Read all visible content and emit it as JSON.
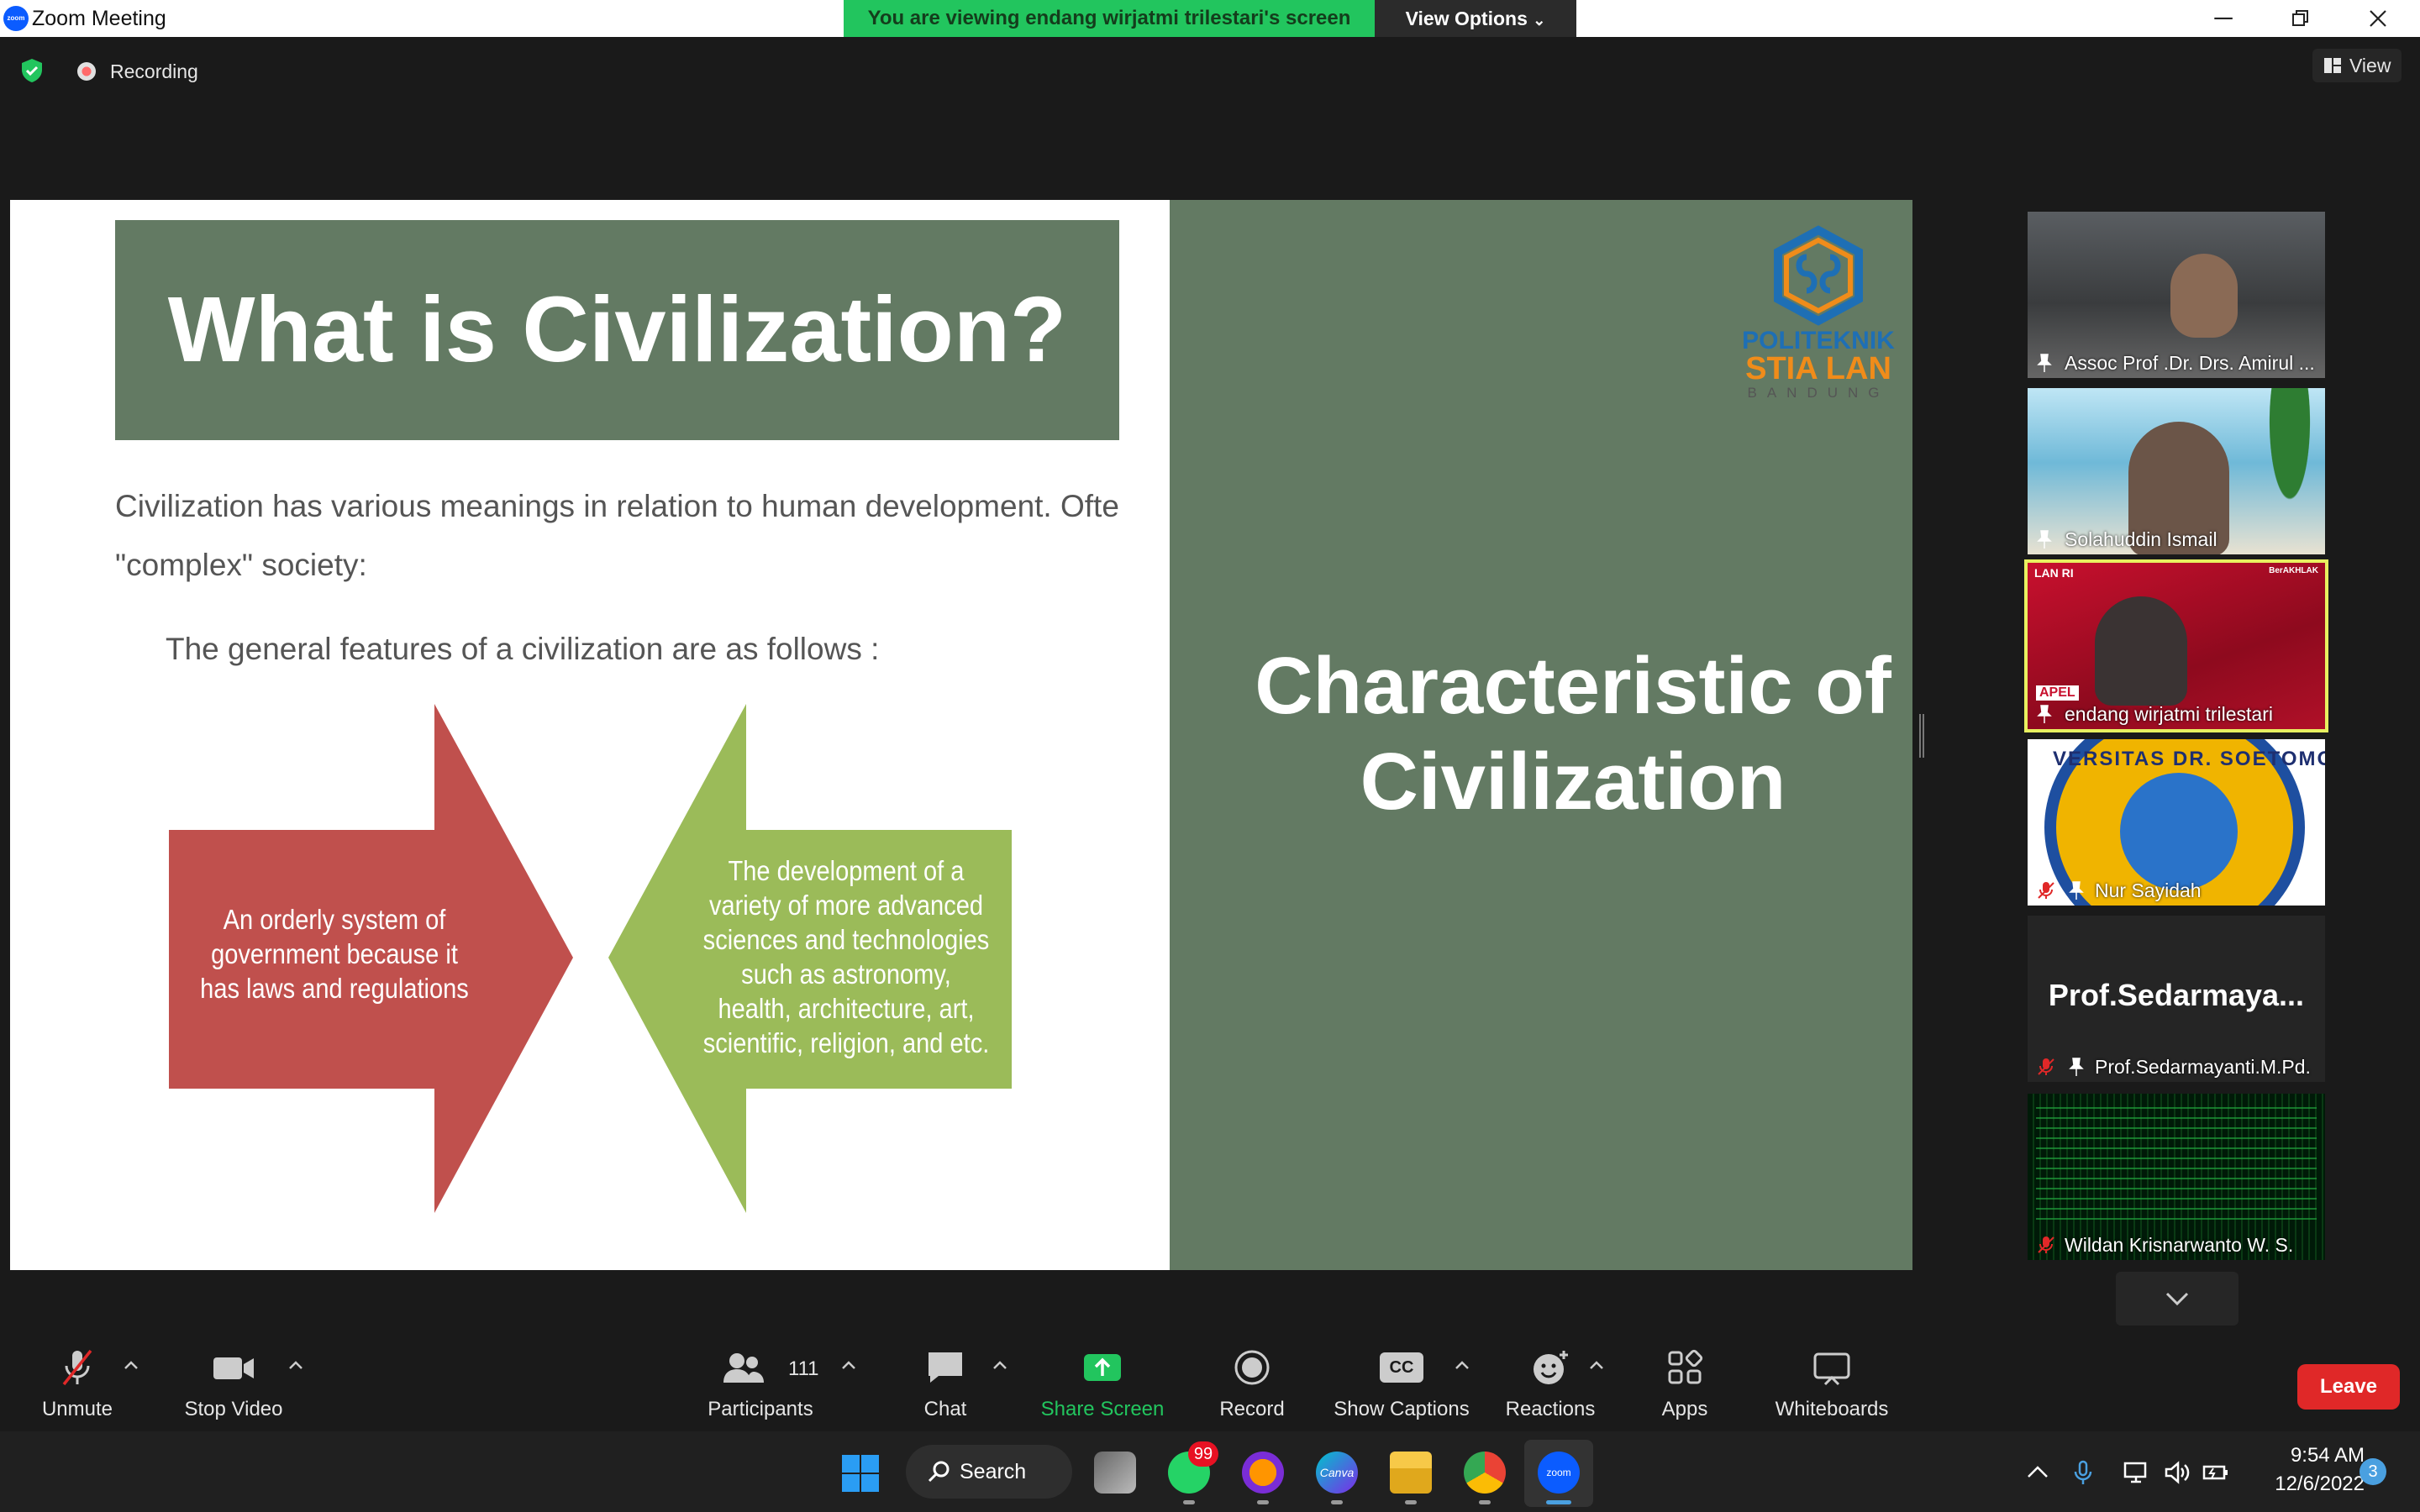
{
  "window": {
    "title": "Zoom Meeting",
    "app_logo_text": "zoom"
  },
  "share_banner": {
    "text": "You are viewing endang wirjatmi trilestari's screen",
    "view_options": "View Options"
  },
  "meeting": {
    "recording_label": "Recording",
    "view_label": "View"
  },
  "slide": {
    "title": "What is Civilization?",
    "paragraph_line1": "Civilization has various meanings in relation to human development. Ofte",
    "paragraph_line2": "\"complex\" society:",
    "subheading": "The general features of a civilization are as follows :",
    "arrow_left_text": "An orderly system of government because it has laws and regulations",
    "arrow_right_text": "The development of a variety of more advanced sciences and technologies such as astronomy, health, architecture, art, scientific, religion, and etc.",
    "right_title": "Characteristic of Civilization",
    "logo_line1": "POLITEKNIK",
    "logo_line2": "STIA LAN",
    "logo_line3": "BANDUNG",
    "colors": {
      "sage": "#637a63",
      "red_arrow": "#c0504d",
      "green_arrow": "#9bbb59"
    }
  },
  "participants_panel": [
    {
      "name": "Assoc Prof .Dr. Drs. Amirul ...",
      "muted": false,
      "pinned": true
    },
    {
      "name": "Solahuddin Ismail",
      "muted": false,
      "pinned": true
    },
    {
      "name": "endang wirjatmi trilestari",
      "muted": false,
      "pinned": true,
      "active_speaker": true,
      "overlay_brand": "LAN RI",
      "overlay_tag": "APEL",
      "overlay_brand2": "BerAKHLAK"
    },
    {
      "name": "Nur Sayidah",
      "muted": true,
      "pinned": true,
      "overlay_text": "VERSITAS DR. SOETOMO"
    },
    {
      "name": "Prof.Sedarmayanti.M.Pd.",
      "display_big": "Prof.Sedarmaya...",
      "muted": true,
      "pinned": true
    },
    {
      "name": "Wildan Krisnarwanto W. S.",
      "muted": true,
      "pinned": false
    }
  ],
  "toolbar": {
    "unmute": "Unmute",
    "stop_video": "Stop Video",
    "participants": "Participants",
    "participants_count": "111",
    "chat": "Chat",
    "share_screen": "Share Screen",
    "record": "Record",
    "show_captions": "Show Captions",
    "captions_icon_text": "CC",
    "reactions": "Reactions",
    "apps": "Apps",
    "whiteboards": "Whiteboards",
    "leave": "Leave"
  },
  "taskbar": {
    "search": "Search",
    "whatsapp_badge": "99",
    "canva_label": "Canva",
    "zoom_label": "zoom",
    "time": "9:54 AM",
    "date": "12/6/2022",
    "notifications": "3"
  }
}
